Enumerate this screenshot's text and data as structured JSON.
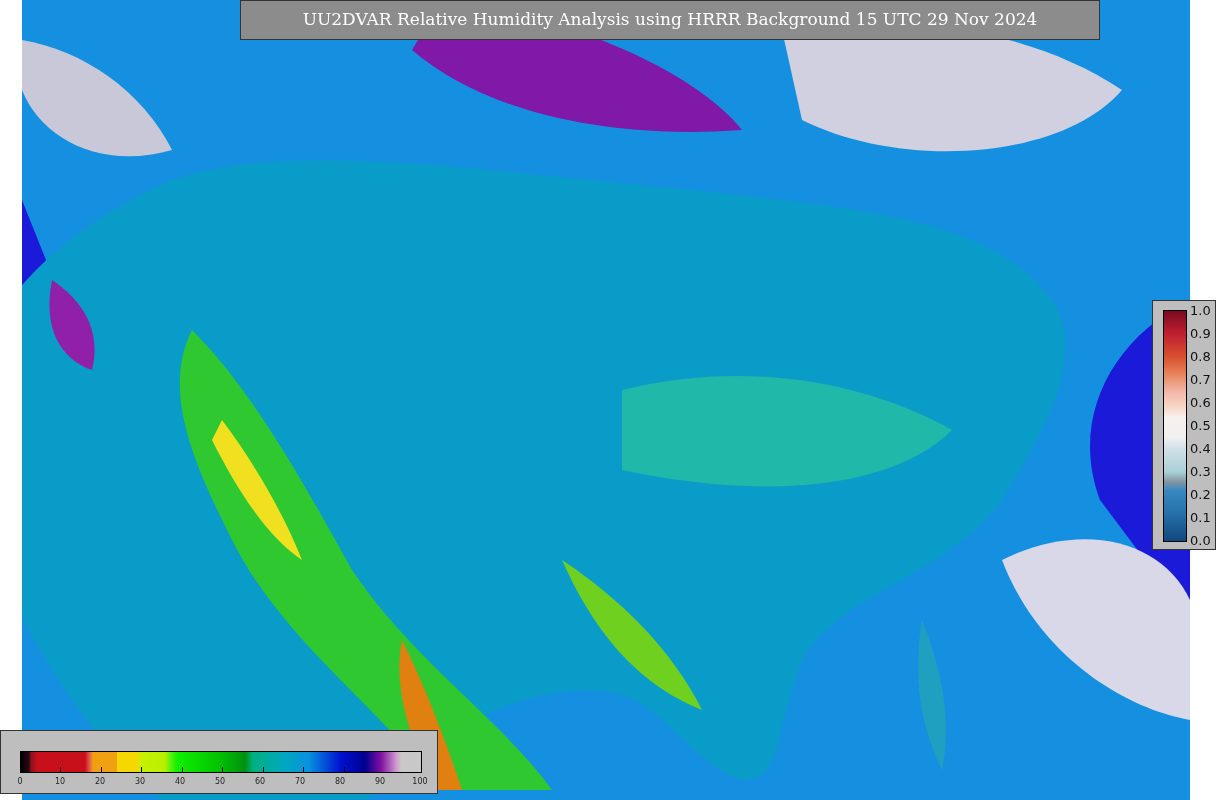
{
  "title": "UU2DVAR Relative Humidity Analysis using HRRR Background 15 UTC 29 Nov 2024",
  "humidity_colorbar": {
    "ticks": [
      "0",
      "10",
      "20",
      "30",
      "40",
      "50",
      "60",
      "70",
      "80",
      "90",
      "100"
    ]
  },
  "station_colorbar": {
    "ticks": [
      "1.0",
      "0.9",
      "0.8",
      "0.7",
      "0.6",
      "0.5",
      "0.4",
      "0.3",
      "0.2",
      "0.1",
      "0.0"
    ]
  }
}
